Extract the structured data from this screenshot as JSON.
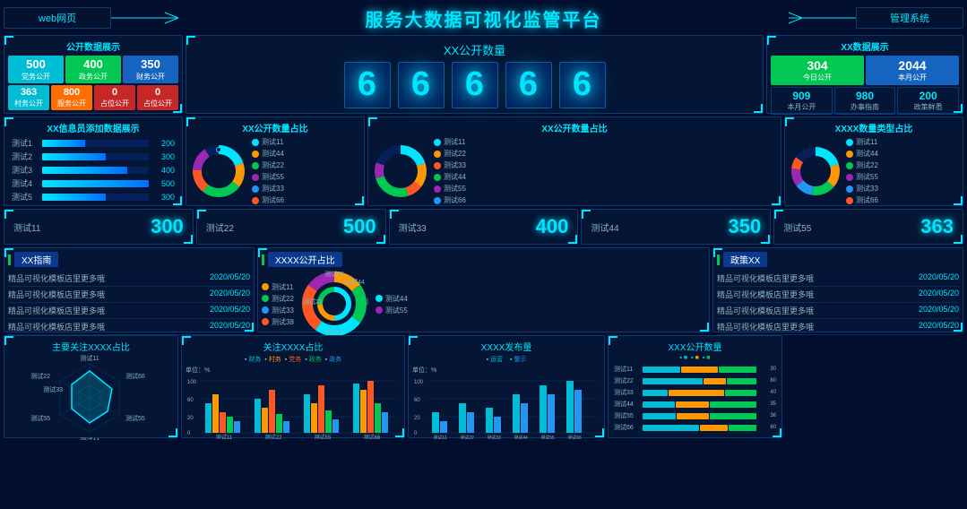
{
  "header": {
    "title": "服务大数据可视化监管平台",
    "nav_left": "web网页",
    "nav_right": "管理系统"
  },
  "public_data": {
    "title": "公开数据展示",
    "stats_row1": [
      {
        "val": "500",
        "lbl": "党务公开",
        "color": "cyan"
      },
      {
        "val": "400",
        "lbl": "政务公开",
        "color": "green"
      },
      {
        "val": "350",
        "lbl": "财务公开",
        "color": "blue"
      }
    ],
    "stats_row2": [
      {
        "val": "363",
        "lbl": "村务公开",
        "color": "cyan"
      },
      {
        "val": "800",
        "lbl": "服务公开",
        "color": "orange"
      },
      {
        "val": "0",
        "lbl": "占位公开",
        "color": "red"
      },
      {
        "val": "0",
        "lbl": "占位公开",
        "color": "red"
      }
    ]
  },
  "open_count": {
    "title": "XX公开数量",
    "numbers": [
      "6",
      "6",
      "6",
      "6",
      "6"
    ]
  },
  "xx_data": {
    "title": "XX数据展示",
    "top_row": [
      {
        "val": "304",
        "lbl": "今日公开",
        "color": "green"
      },
      {
        "val": "2044",
        "lbl": "本月公开",
        "color": "blue2"
      }
    ],
    "bottom_row": [
      {
        "val": "909",
        "lbl": "本月公开"
      },
      {
        "val": "980",
        "lbl": "办事指南"
      },
      {
        "val": "200",
        "lbl": "政策鲜悉"
      }
    ]
  },
  "info_bar": {
    "title": "XX信息员添加数据展示",
    "items": [
      {
        "lbl": "测试1",
        "val": 200
      },
      {
        "lbl": "测试2",
        "val": 300
      },
      {
        "lbl": "测试3",
        "val": 400
      },
      {
        "lbl": "测试4",
        "val": 500
      },
      {
        "lbl": "测试5",
        "val": 300
      }
    ]
  },
  "donut1": {
    "title": "XX公开数量占比",
    "legend": [
      {
        "lbl": "测试11",
        "color": "#00e5ff"
      },
      {
        "lbl": "测试22",
        "color": "#ff9800"
      },
      {
        "lbl": "测试33",
        "color": "#00c853"
      },
      {
        "lbl": "测试44",
        "color": "#ff5722"
      },
      {
        "lbl": "测试55",
        "color": "#9c27b0"
      },
      {
        "lbl": "测试66",
        "color": "#2196f3"
      }
    ],
    "data": [
      20,
      15,
      25,
      15,
      15,
      10
    ]
  },
  "donut2": {
    "title": "XX公开数量占比",
    "legend": [
      {
        "lbl": "测试11",
        "color": "#00e5ff"
      },
      {
        "lbl": "测试22",
        "color": "#ff9800"
      },
      {
        "lbl": "测试33",
        "color": "#00c853"
      },
      {
        "lbl": "测试44",
        "color": "#ff5722"
      },
      {
        "lbl": "测试55",
        "color": "#9c27b0"
      },
      {
        "lbl": "测试66",
        "color": "#2196f3"
      }
    ],
    "data": [
      20,
      15,
      25,
      15,
      15,
      10
    ]
  },
  "donut3": {
    "title": "XXXX数量类型占比",
    "legend": [
      {
        "lbl": "测试11",
        "color": "#00e5ff"
      },
      {
        "lbl": "测试22",
        "color": "#ff9800"
      },
      {
        "lbl": "测试33",
        "color": "#00c853"
      },
      {
        "lbl": "测试44",
        "color": "#2196f3"
      },
      {
        "lbl": "测试55",
        "color": "#9c27b0"
      },
      {
        "lbl": "测试66",
        "color": "#ff5722"
      }
    ],
    "data": [
      20,
      20,
      20,
      15,
      15,
      10
    ]
  },
  "stat_boxes": [
    {
      "lbl": "测试11",
      "val": "300"
    },
    {
      "lbl": "测试22",
      "val": "500"
    },
    {
      "lbl": "测试33",
      "val": "400"
    },
    {
      "lbl": "测试44",
      "val": "350"
    },
    {
      "lbl": "测试55",
      "val": "363"
    }
  ],
  "guide_list": {
    "title": "XX指南",
    "items": [
      {
        "text": "精品可视化模板店里更多哦",
        "date": "2020/05/20"
      },
      {
        "text": "精品可视化模板店里更多哦",
        "date": "2020/05/20"
      },
      {
        "text": "精品可视化模板店里更多哦",
        "date": "2020/05/20"
      },
      {
        "text": "精品可视化模板店里更多哦",
        "date": "2020/05/20"
      }
    ]
  },
  "donut_mid": {
    "title": "XXXX公开占比",
    "legend": [
      {
        "lbl": "测试11",
        "color": "#ff9800"
      },
      {
        "lbl": "测试22",
        "color": "#00c853"
      },
      {
        "lbl": "测试33",
        "color": "#2196f3"
      },
      {
        "lbl": "测试44",
        "color": "#00e5ff"
      },
      {
        "lbl": "测试55",
        "color": "#9c27b0"
      },
      {
        "lbl": "测试38",
        "color": "#ff5722"
      }
    ],
    "labels": [
      "测试11",
      "测试22",
      "测试33",
      "测试44",
      "测试55"
    ],
    "data": [
      15,
      20,
      25,
      25,
      15
    ]
  },
  "policy_list": {
    "title": "政策XX",
    "items": [
      {
        "text": "精品可视化模板店里更多哦",
        "date": "2020/05/20"
      },
      {
        "text": "精品可视化模板店里更多哦",
        "date": "2020/05/20"
      },
      {
        "text": "精品可视化模板店里更多哦",
        "date": "2020/05/20"
      },
      {
        "text": "精品可视化模板店里更多哦",
        "date": "2020/05/20"
      }
    ]
  },
  "radar": {
    "title": "主要关注XXXX占比",
    "labels": [
      "测试11",
      "测试22",
      "测试33",
      "测试44",
      "测试55",
      "测试66"
    ]
  },
  "bar_group": {
    "title": "关注XXXX占比",
    "unit": "单位：%",
    "categories": [
      "测试11",
      "测试22",
      "测试55",
      "测试66"
    ],
    "legend": [
      "财务",
      "村务",
      "党务",
      "政务",
      "政务"
    ],
    "colors": [
      "#00bcd4",
      "#ff9800",
      "#ff5722",
      "#00c853",
      "#2196f3"
    ]
  },
  "bar_publish": {
    "title": "XXXX发布量",
    "unit": "单位：%",
    "categories": [
      "测试11",
      "测试22",
      "测试33",
      "测试44",
      "测试55",
      "测试66"
    ],
    "legend": [
      "运营",
      "警示"
    ],
    "colors": [
      "#00bcd4",
      "#2196f3"
    ]
  },
  "hbar": {
    "title": "XXX公开数量",
    "categories": [
      "测试11",
      "测试22",
      "测试33",
      "测试44",
      "测试55",
      "测试66"
    ],
    "series": [
      {
        "color": "#00bcd4",
        "data": [
          30,
          80,
          40,
          35,
          36,
          60
        ]
      },
      {
        "color": "#ff9800",
        "data": [
          30,
          30,
          90,
          35,
          35,
          30
        ]
      },
      {
        "color": "#00c853",
        "data": [
          30,
          40,
          50,
          50,
          50,
          30
        ]
      }
    ]
  }
}
